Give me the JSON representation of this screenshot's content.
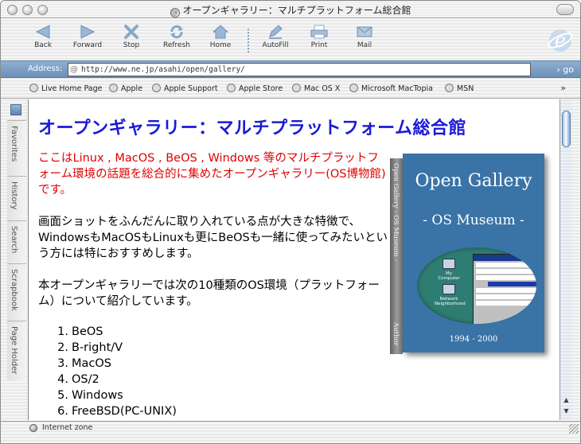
{
  "window": {
    "title": "オープンギャラリー：マルチプラットフォーム総合館"
  },
  "toolbar": {
    "buttons": [
      {
        "label": "Back",
        "icon": "back-arrow-icon"
      },
      {
        "label": "Forward",
        "icon": "forward-arrow-icon"
      },
      {
        "label": "Stop",
        "icon": "stop-x-icon"
      },
      {
        "label": "Refresh",
        "icon": "refresh-icon"
      },
      {
        "label": "Home",
        "icon": "home-icon"
      },
      {
        "label": "AutoFill",
        "icon": "autofill-pen-icon"
      },
      {
        "label": "Print",
        "icon": "printer-icon"
      },
      {
        "label": "Mail",
        "icon": "mail-envelope-icon"
      }
    ]
  },
  "address": {
    "label": "Address:",
    "url": "http://www.ne.jp/asahi/open/gallery/",
    "go_label": "go"
  },
  "favorites": {
    "items": [
      "Live Home Page",
      "Apple",
      "Apple Support",
      "Apple Store",
      "Mac OS X",
      "Microsoft MacTopia",
      "MSN"
    ],
    "more": "»"
  },
  "sidebar": {
    "tabs": [
      "Favorites",
      "History",
      "Search",
      "Scrapbook",
      "Page Holder"
    ]
  },
  "page": {
    "heading": "オープンギャラリー：マルチプラットフォーム総合館",
    "intro": "ここはLinux , MacOS , BeOS , Windows 等のマルチプラットフォーム環境の話題を総合的に集めたオープンギャラリー(OS博物館)です。",
    "para1": "画面ショットをふんだんに取り入れている点が大きな特徴で、WindowsもMacOSもLinuxも更にBeOSも一緒に使ってみたいという方には特におすすめします。",
    "para2": "本オープンギャラリーでは次の10種類のOS環境（プラットフォーム）について紹介しています。",
    "os_list": [
      {
        "num": "1.",
        "name": "BeOS"
      },
      {
        "num": "2.",
        "name": "B-right/V"
      },
      {
        "num": "3.",
        "name": "MacOS"
      },
      {
        "num": "4.",
        "name": "OS/2"
      },
      {
        "num": "5.",
        "name": "Windows"
      },
      {
        "num": "6.",
        "name": "FreeBSD(PC-UNIX)"
      }
    ]
  },
  "book": {
    "spine_text": "Open Gallery - OS Museum -",
    "spine_author": "Author",
    "cover_title": "Open Gallery",
    "cover_subtitle": "- OS Museum -",
    "cover_years": "1994 - 2000",
    "icon_labels": [
      "My Computer",
      "Network Neighborhood"
    ]
  },
  "status": {
    "text": "Internet zone"
  }
}
